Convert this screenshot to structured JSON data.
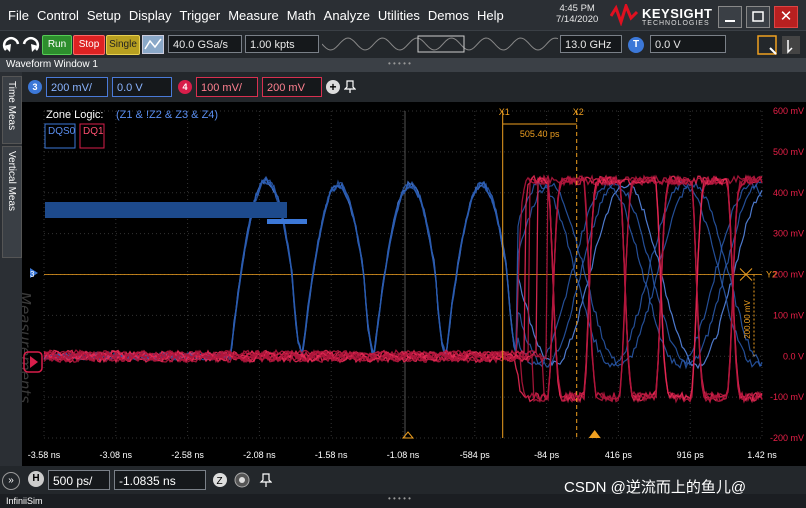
{
  "menu": [
    "File",
    "Control",
    "Setup",
    "Display",
    "Trigger",
    "Measure",
    "Math",
    "Analyze",
    "Utilities",
    "Demos",
    "Help"
  ],
  "datetime": {
    "time": "4:45 PM",
    "date": "7/14/2020"
  },
  "logo": {
    "brand": "KEYSIGHT",
    "sub": "TECHNOLOGIES"
  },
  "toolbar": {
    "run": "Run",
    "stop": "Stop",
    "single": "Single",
    "sample_rate": "40.0 GSa/s",
    "points": "1.00 kpts",
    "bandwidth": "13.0 GHz",
    "trigger_level": "0.0 V"
  },
  "window_title": "Waveform Window 1",
  "side_tabs": [
    "Time Meas",
    "Vertical Meas"
  ],
  "channels": {
    "ch3_scale": "200 mV/",
    "ch3_offset": "0.0 V",
    "ch4_scale": "100 mV/",
    "ch4_offset": "200 mV",
    "ch3_num": "3",
    "ch4_num": "4"
  },
  "zone_logic": {
    "label": "Zone Logic:",
    "expr": "(Z1 & !Z2 & Z3 & Z4)"
  },
  "waveform_labels": {
    "dqs": "DQS0",
    "dq": "DQ1"
  },
  "markers": {
    "x1": "X1",
    "x2": "X2",
    "delta": "505.40 ps",
    "y2": "Y2",
    "y_delta": "200.00 mV"
  },
  "measurements_watermark": "Measurements",
  "horizontal": {
    "icon": "H",
    "timebase": "500 ps/",
    "position": "-1.0835 ns"
  },
  "status_app": "InfiniiSim",
  "watermark": "CSDN @逆流而上的鱼儿@",
  "colors": {
    "dqs": "#3c78d8",
    "dq": "#d81e4a",
    "cursor": "#f0a020"
  },
  "chart_data": {
    "type": "line",
    "x_tick_labels": [
      "-3.58 ns",
      "-3.08 ns",
      "-2.58 ns",
      "-2.08 ns",
      "-1.58 ns",
      "-1.08 ns",
      "-584 ps",
      "-84 ps",
      "416 ps",
      "916 ps",
      "1.42 ns"
    ],
    "y_tick_labels": [
      "600 mV",
      "500 mV",
      "400 mV",
      "300 mV",
      "200 mV",
      "100 mV",
      "0.0 V",
      "-100 mV",
      "-200 mV"
    ],
    "x_unit": "ns",
    "xlim": [
      -3.58,
      1.42
    ],
    "ylim_mV": [
      -200,
      600
    ],
    "grid": true,
    "series": [
      {
        "name": "DQS0",
        "color": "#3c78d8",
        "idle_mV": 0,
        "pulses": [
          {
            "start": -2.28,
            "end": -1.78,
            "high_mV": 430
          },
          {
            "start": -1.78,
            "end": -1.28,
            "high_mV": 420
          },
          {
            "start": -1.28,
            "end": -0.78,
            "high_mV": 420
          },
          {
            "start": -0.78,
            "end": -0.28,
            "high_mV": 420
          }
        ]
      },
      {
        "name": "DQ1",
        "color": "#d81e4a",
        "idle_mV": 0,
        "eye_start": -0.32,
        "high_mV": 430,
        "low_mV": -100
      }
    ]
  }
}
